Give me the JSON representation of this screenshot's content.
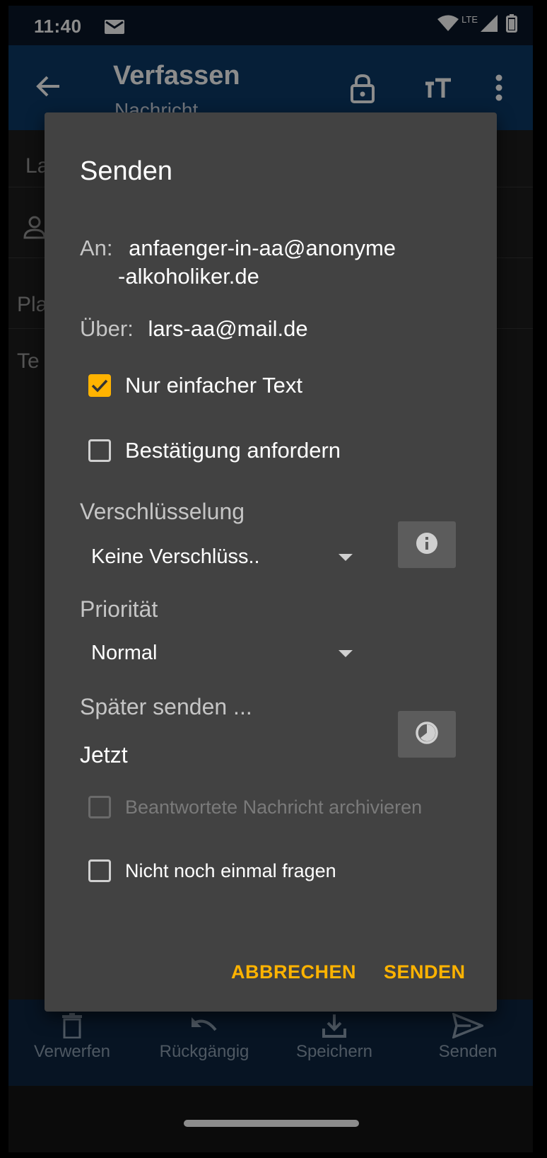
{
  "status_bar": {
    "time": "11:40",
    "network": "LTE",
    "icons": [
      "mail-icon",
      "wifi-icon",
      "signal-icon",
      "battery-icon"
    ]
  },
  "app_bar": {
    "title": "Verfassen",
    "subtitle": "Nachricht",
    "icons": [
      "back-arrow-icon",
      "lock-icon",
      "text-size-icon",
      "more-vert-icon"
    ]
  },
  "background_form": {
    "row1": "La",
    "row3": "Pla",
    "row4": "Te"
  },
  "dialog": {
    "title": "Senden",
    "to_label": "An:",
    "to_line1": "anfaenger-in-aa@anonyme",
    "to_line2": "-alkoholiker.de",
    "via_label": "Über:",
    "via_value": "lars-aa@mail.de",
    "plain_text_label": "Nur einfacher Text",
    "plain_text_checked": true,
    "receipt_label": "Bestätigung anfordern",
    "receipt_checked": false,
    "encryption_label": "Verschlüsselung",
    "encryption_value": "Keine Verschlüss..",
    "priority_label": "Priorität",
    "priority_value": "Normal",
    "send_later_label": "Später senden ...",
    "send_later_value": "Jetzt",
    "archive_label": "Beantwortete Nachricht archivieren",
    "archive_enabled": false,
    "dont_ask_label": "Nicht noch einmal fragen",
    "cancel_label": "ABBRECHEN",
    "send_label": "SENDEN"
  },
  "bottom_bar": {
    "discard": "Verwerfen",
    "undo": "Rückgängig",
    "save": "Speichern",
    "send": "Senden"
  },
  "colors": {
    "accent": "#ffb300",
    "dialog_bg": "#424242",
    "app_bar": "#0b3a66",
    "bottom_bar": "#0d2540"
  }
}
